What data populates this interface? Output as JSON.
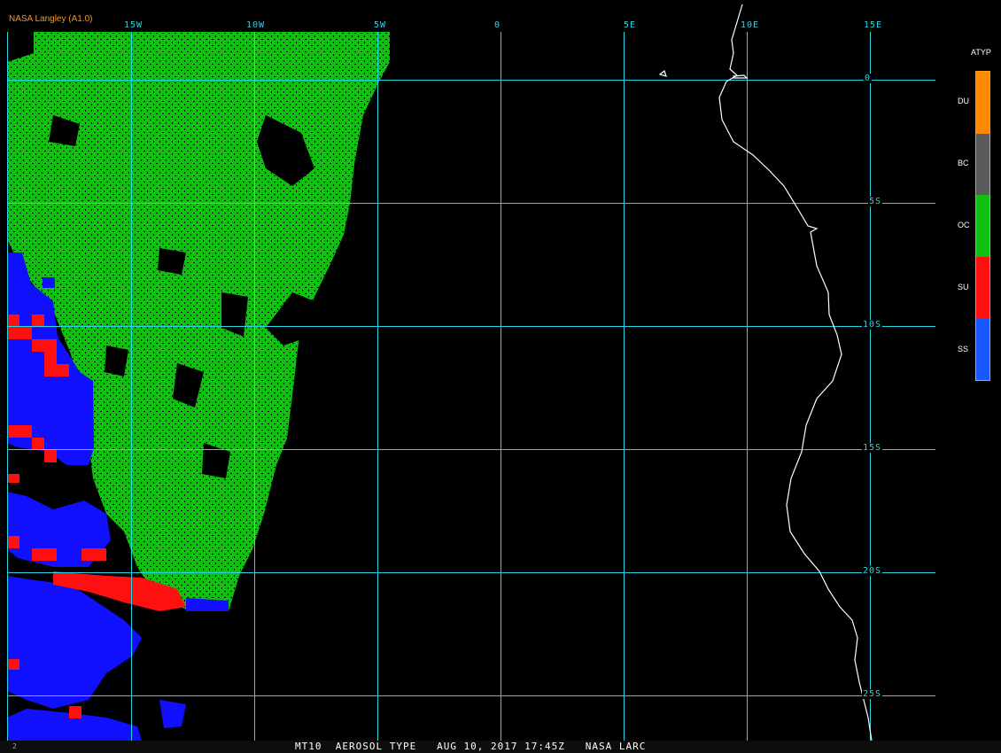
{
  "source_label": "NASA Langley (A1.0)",
  "longitude_labels": [
    "15W",
    "10W",
    "5W",
    "0",
    "5E",
    "10E",
    "15E"
  ],
  "latitude_labels": [
    "0",
    "5S",
    "10S",
    "15S",
    "20S",
    "25S"
  ],
  "legend": {
    "title": "ATYP",
    "items": [
      {
        "label": "DU",
        "color": "#ff8a00"
      },
      {
        "label": "BC",
        "color": "#5a5a5a"
      },
      {
        "label": "OC",
        "color": "#10c010"
      },
      {
        "label": "SU",
        "color": "#ff1010"
      },
      {
        "label": "SS",
        "color": "#1858ff"
      }
    ]
  },
  "colors": {
    "grid": "#29d6e6",
    "ocean_background": "#000000",
    "coastline": "#ffffff",
    "oc_aerosol": "#10c010",
    "su_aerosol": "#ff1010",
    "ss_aerosol": "#1010ff"
  },
  "footer": {
    "title": "MT10  AEROSOL TYPE   AUG 10, 2017 17:45Z   NASA LARC",
    "frame_number": "2"
  }
}
